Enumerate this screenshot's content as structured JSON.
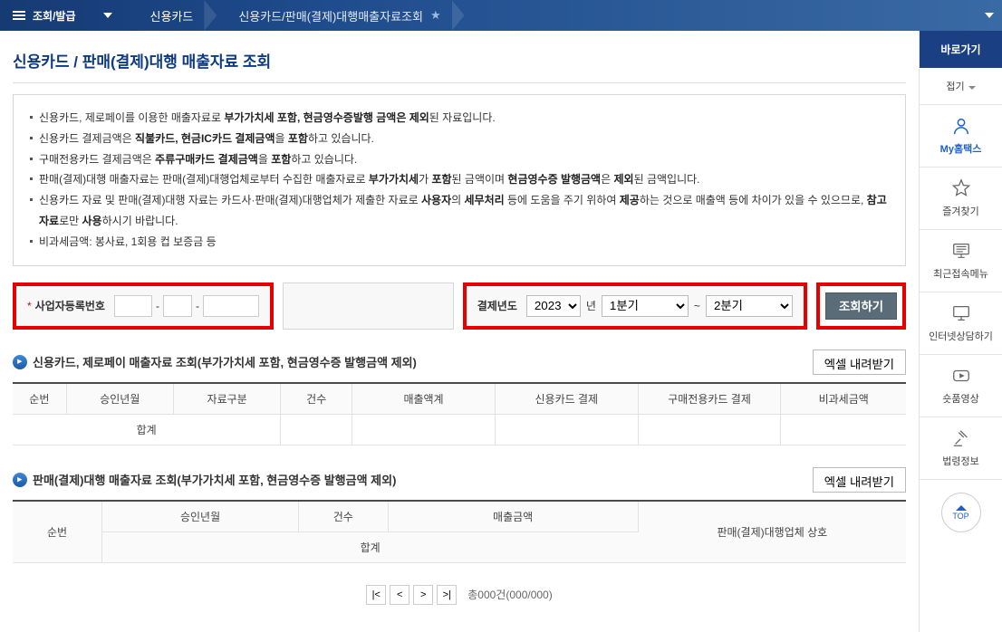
{
  "nav": {
    "menu_label": "조회/발급",
    "crumb1": "신용카드",
    "crumb2": "신용카드/판매(결제)대행매출자료조회"
  },
  "page_title": "신용카드 / 판매(결제)대행 매출자료 조회",
  "notices": [
    "신용카드, 제로페이를 이용한 매출자료로 <b>부가가치세 포함, 현금영수증발행 금액은 제외</b>된 자료입니다.",
    "신용카드 결제금액은 <b>직불카드, 현금IC카드 결제금액</b>을 <b>포함</b>하고 있습니다.",
    "구매전용카드 결제금액은 <b>주류구매카드 결제금액</b>을 <b>포함</b>하고 있습니다.",
    "판매(결제)대행 매출자료는 판매(결제)대행업체로부터 수집한 매출자료로 <b>부가가치세</b>가 <b>포함</b>된 금액이며 <b>현금영수증 발행금액</b>은 <b>제외</b>된 금액입니다.",
    "신용카드 자료 및 판매(결제)대행 자료는 카드사·판매(결제)대행업체가 제출한 자료로 <b>사용자</b>의 <b>세무처리</b> 등에 도움을 주기 위하여 <b>제공</b>하는 것으로 매출액 등에 차이가 있을 수 있으므로, <b>참고 자료</b>로만 <b>사용</b>하시기 바랍니다.",
    "비과세금액: 봉사료, 1회용 컵 보증금 등"
  ],
  "search": {
    "brn_label": "사업자등록번호",
    "year_label": "결제년도",
    "year_value": "2023",
    "year_suffix": "년",
    "q_from": "1분기",
    "q_to": "2분기",
    "submit": "조회하기"
  },
  "section1": {
    "title": "신용카드, 제로페이 매출자료 조회(부가가치세 포함, 현금영수증 발행금액 제외)",
    "excel": "엑셀 내려받기",
    "cols": {
      "c1": "순번",
      "c2": "승인년월",
      "c3": "자료구분",
      "c4": "건수",
      "c5": "매출액계",
      "c6": "신용카드 결제",
      "c7": "구매전용카드 결제",
      "c8": "비과세금액"
    },
    "sum": "합계"
  },
  "section2": {
    "title": "판매(결제)대행 매출자료 조회(부가가치세 포함, 현금영수증 발행금액 제외)",
    "excel": "엑셀 내려받기",
    "cols": {
      "c1": "순번",
      "c2": "승인년월",
      "c3": "건수",
      "c4": "매출금액",
      "c5": "판매(결제)대행업체 상호"
    },
    "sum": "합계"
  },
  "pager": {
    "info": "총000건(000/000)"
  },
  "sidebar": {
    "title": "바로가기",
    "items": [
      "접기",
      "My홈택스",
      "즐겨찾기",
      "최근접속메뉴",
      "인터넷상담하기",
      "숏품영상",
      "법령정보"
    ],
    "top": "TOP"
  }
}
